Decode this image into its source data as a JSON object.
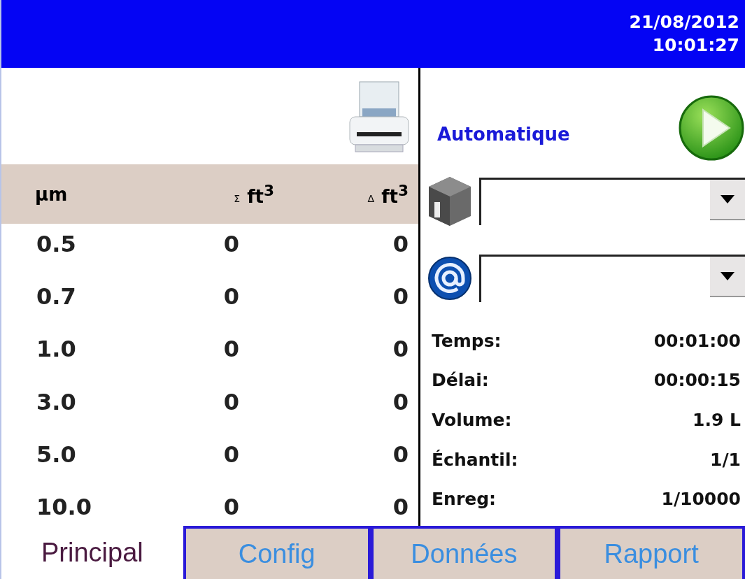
{
  "header": {
    "date": "21/08/2012",
    "time": "10:01:27"
  },
  "table": {
    "columns": [
      {
        "label": "μm"
      },
      {
        "symbol": "Σ",
        "label": "ft$^{3}$"
      },
      {
        "symbol": "Δ",
        "label": "ft$^{3}$"
      }
    ],
    "rows": [
      [
        "0.5",
        "0",
        "0"
      ],
      [
        "0.7",
        "0",
        "0"
      ],
      [
        "1.0",
        "0",
        "0"
      ],
      [
        "3.0",
        "0",
        "0"
      ],
      [
        "5.0",
        "0",
        "0"
      ],
      [
        "10.0",
        "0",
        "0"
      ]
    ]
  },
  "mode": "Automatique",
  "dropdowns": [
    {
      "kind": "device"
    },
    {
      "kind": "email"
    }
  ],
  "fields": [
    {
      "label": "Temps:",
      "value": "00:01:00"
    },
    {
      "label": "Délai:",
      "value": "00:00:15"
    },
    {
      "label": "Volume:",
      "value": "1.9 L"
    },
    {
      "label": "Échantil:",
      "value": "1/1"
    },
    {
      "label": "Enreg:",
      "value": "1/10000"
    }
  ],
  "tabs": [
    {
      "label": "Principal",
      "selected": true
    },
    {
      "label": "Config",
      "selected": false
    },
    {
      "label": "Données",
      "selected": false
    },
    {
      "label": "Rapport",
      "selected": false
    }
  ]
}
